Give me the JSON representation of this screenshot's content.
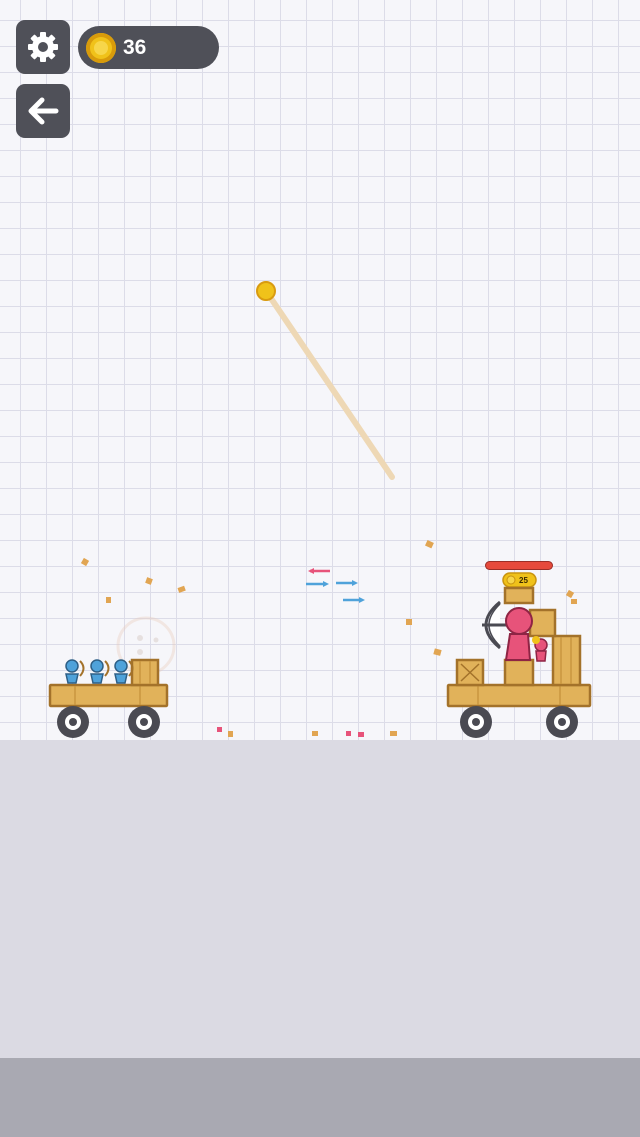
{
  "hud": {
    "coins": "36",
    "settings_icon": "gear-icon",
    "back_icon": "back-arrow-icon",
    "coin_icon": "coin-icon"
  },
  "enemy": {
    "reward_coins": "25",
    "health_fraction": 1.0,
    "team_color": "#e7537a"
  },
  "player": {
    "archers": 3,
    "team_color": "#4fa2da"
  },
  "colors": {
    "wood": "#e1b25a",
    "wood_dark": "#a3722a",
    "coin": "#f0c21a",
    "rope": "#f0d7b2",
    "health_bar": "#e64a3c"
  }
}
